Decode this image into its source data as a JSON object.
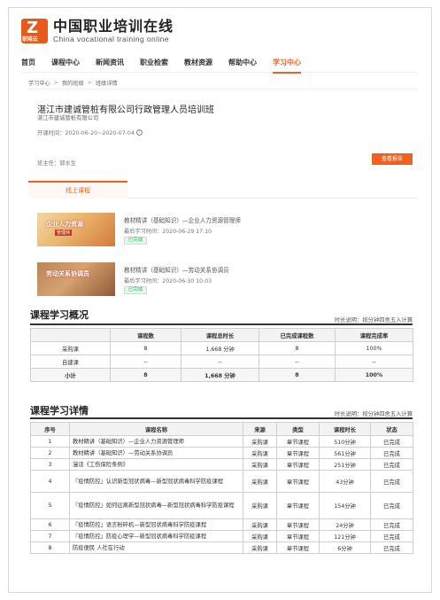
{
  "header": {
    "logo_badge": "职培云",
    "title_cn": "中国职业培训在线",
    "title_en": "China vocational training online"
  },
  "nav": [
    {
      "label": "首页"
    },
    {
      "label": "课程中心"
    },
    {
      "label": "新闻资讯"
    },
    {
      "label": "职业检索"
    },
    {
      "label": "教材资源"
    },
    {
      "label": "帮助中心"
    },
    {
      "label": "学习中心"
    }
  ],
  "nav_active_index": 6,
  "breadcrumb": [
    "学习中心",
    "我的班级",
    "班级详情"
  ],
  "class_info": {
    "title": "湛江市建诚管桩有限公司行政管理人员培训班",
    "org": "湛江市建诚管桩有限公司",
    "period": "开课时间：2020-06-20~2020-07-04",
    "teacher": "班主任：郭水生",
    "report_button": "查看报告"
  },
  "tabs": [
    {
      "label": "线上课程"
    }
  ],
  "courses": [
    {
      "name": "教材精讲（基础知识）—企业人力资源管理师",
      "last_study": "最后学习时间：2020-06-29 17:10",
      "status": "已完成",
      "thumb_text": "企业人力资源",
      "thumb_sub": "管理师"
    },
    {
      "name": "教材精讲（基础知识）—劳动关系协调员",
      "last_study": "最后学习时间：2020-06-30 10:03",
      "status": "已完成",
      "thumb_text": "劳动关系协调员",
      "thumb_sub": ""
    }
  ],
  "summary": {
    "title": "课程学习概况",
    "note": "时长说明：按分钟四舍五入计算",
    "headers": [
      "",
      "课程数",
      "课程总时长",
      "已完成课程数",
      "课程完成率"
    ],
    "rows": [
      [
        "采购课",
        "8",
        "1,668 分钟",
        "8",
        "100%"
      ],
      [
        "自建课",
        "--",
        "--",
        "--",
        "--"
      ]
    ],
    "total": [
      "小计",
      "8",
      "1,668 分钟",
      "8",
      "100%"
    ]
  },
  "detail": {
    "title": "课程学习详情",
    "note": "时长说明：按分钟四舍五入计算",
    "headers": [
      "序号",
      "课程名称",
      "来源",
      "类型",
      "课程时长",
      "状态"
    ],
    "rows": [
      [
        "1",
        "教材精讲（基础知识）—企业人力资源管理师",
        "采购课",
        "章节课程",
        "510分钟",
        "已完成"
      ],
      [
        "2",
        "教材精讲（基础知识）—劳动关系协调员",
        "采购课",
        "章节课程",
        "561分钟",
        "已完成"
      ],
      [
        "3",
        "漫话《工伤保险条例》",
        "采购课",
        "章节课程",
        "251分钟",
        "已完成"
      ],
      [
        "4",
        "『疫情防控』认识新型冠状病毒—新型冠状病毒科学防疫课程",
        "采购课",
        "章节课程",
        "43分钟",
        "已完成"
      ],
      [
        "5",
        "『疫情防控』如何远离新型冠状病毒—新型冠状病毒科学防疫课程",
        "采购课",
        "章节课程",
        "154分钟",
        "已完成"
      ],
      [
        "6",
        "『疫情防控』语言粉碎机—新型冠状病毒科学防疫课程",
        "采购课",
        "章节课程",
        "24分钟",
        "已完成"
      ],
      [
        "7",
        "『疫情防控』防疫心理学—新型冠状病毒科学防疫课程",
        "采购课",
        "章节课程",
        "121分钟",
        "已完成"
      ],
      [
        "8",
        "防疫便民 人社在行动",
        "采购课",
        "章节课程",
        "6分钟",
        "已完成"
      ]
    ]
  },
  "colors": {
    "accent": "#f0601e",
    "success": "#3bb26b"
  }
}
